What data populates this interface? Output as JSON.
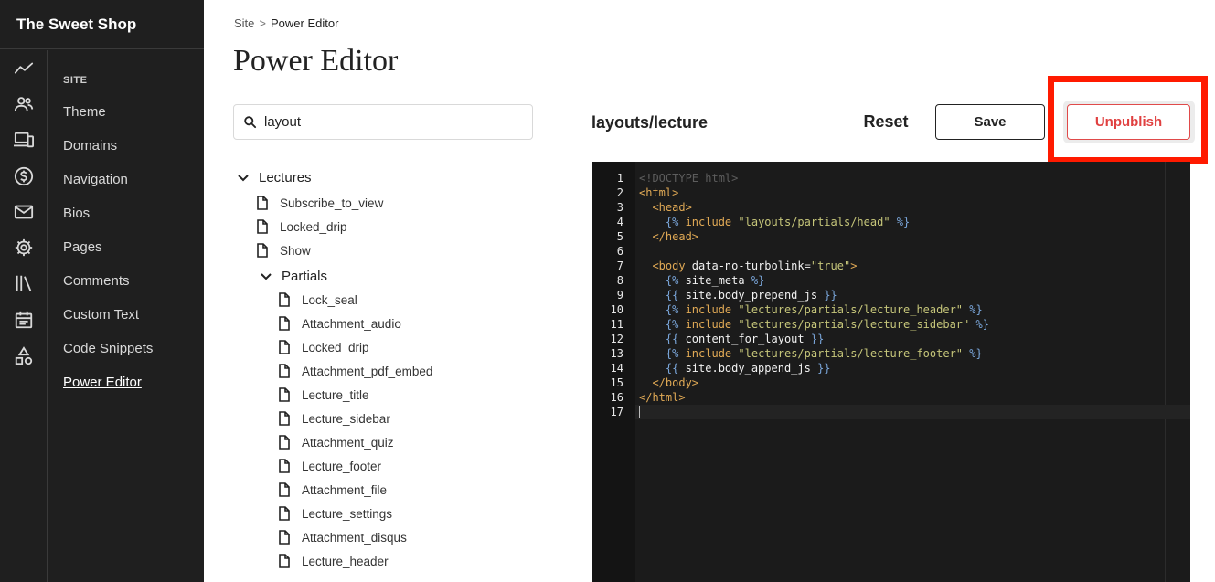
{
  "app": {
    "brand": "The Sweet Shop"
  },
  "sidebar": {
    "section_label": "SITE",
    "icons": [
      "analytics-icon",
      "users-icon",
      "devices-icon",
      "dollar-icon",
      "mail-icon",
      "gear-icon",
      "library-icon",
      "calendar-icon",
      "shapes-icon"
    ],
    "items": [
      {
        "label": "Theme"
      },
      {
        "label": "Domains"
      },
      {
        "label": "Navigation"
      },
      {
        "label": "Bios"
      },
      {
        "label": "Pages"
      },
      {
        "label": "Comments"
      },
      {
        "label": "Custom Text"
      },
      {
        "label": "Code Snippets"
      },
      {
        "label": "Power Editor",
        "active": true
      }
    ]
  },
  "breadcrumb": {
    "root": "Site",
    "separator": ">",
    "current": "Power Editor"
  },
  "page": {
    "title": "Power Editor"
  },
  "search": {
    "value": "layout",
    "placeholder": ""
  },
  "tree": {
    "folder_lectures": "Lectures",
    "lectures_files": [
      "Subscribe_to_view",
      "Locked_drip",
      "Show"
    ],
    "folder_partials": "Partials",
    "partials_files": [
      "Lock_seal",
      "Attachment_audio",
      "Locked_drip",
      "Attachment_pdf_embed",
      "Lecture_title",
      "Lecture_sidebar",
      "Attachment_quiz",
      "Lecture_footer",
      "Attachment_file",
      "Lecture_settings",
      "Attachment_disqus",
      "Lecture_header"
    ]
  },
  "editor": {
    "file_path": "layouts/lecture",
    "reset_label": "Reset",
    "save_label": "Save",
    "unpublish_label": "Unpublish",
    "line_numbers": [
      "1",
      "2",
      "3",
      "4",
      "5",
      "6",
      "7",
      "8",
      "9",
      "10",
      "11",
      "12",
      "13",
      "14",
      "15",
      "16",
      "17"
    ],
    "lines": [
      [
        {
          "t": "<!DOCTYPE html>",
          "c": "cm"
        }
      ],
      [
        {
          "t": "<html>",
          "c": "tag"
        }
      ],
      [
        {
          "t": "  ",
          "c": "pl"
        },
        {
          "t": "<head>",
          "c": "tag"
        }
      ],
      [
        {
          "t": "    ",
          "c": "pl"
        },
        {
          "t": "{%",
          "c": "del"
        },
        {
          "t": " include ",
          "c": "kw"
        },
        {
          "t": "\"layouts/partials/head\"",
          "c": "str"
        },
        {
          "t": " %}",
          "c": "del"
        }
      ],
      [
        {
          "t": "  ",
          "c": "pl"
        },
        {
          "t": "</head>",
          "c": "tag"
        }
      ],
      [],
      [
        {
          "t": "  ",
          "c": "pl"
        },
        {
          "t": "<body",
          "c": "tag"
        },
        {
          "t": " data-no-turbolink",
          "c": "attr"
        },
        {
          "t": "=",
          "c": "pl"
        },
        {
          "t": "\"true\"",
          "c": "str"
        },
        {
          "t": ">",
          "c": "tag"
        }
      ],
      [
        {
          "t": "    ",
          "c": "pl"
        },
        {
          "t": "{%",
          "c": "del"
        },
        {
          "t": " site_meta ",
          "c": "var"
        },
        {
          "t": "%}",
          "c": "del"
        }
      ],
      [
        {
          "t": "    ",
          "c": "pl"
        },
        {
          "t": "{{",
          "c": "del"
        },
        {
          "t": " site.body_prepend_js ",
          "c": "var"
        },
        {
          "t": "}}",
          "c": "del"
        }
      ],
      [
        {
          "t": "    ",
          "c": "pl"
        },
        {
          "t": "{%",
          "c": "del"
        },
        {
          "t": " include ",
          "c": "kw"
        },
        {
          "t": "\"lectures/partials/lecture_header\"",
          "c": "str"
        },
        {
          "t": " %}",
          "c": "del"
        }
      ],
      [
        {
          "t": "    ",
          "c": "pl"
        },
        {
          "t": "{%",
          "c": "del"
        },
        {
          "t": " include ",
          "c": "kw"
        },
        {
          "t": "\"lectures/partials/lecture_sidebar\"",
          "c": "str"
        },
        {
          "t": " %}",
          "c": "del"
        }
      ],
      [
        {
          "t": "    ",
          "c": "pl"
        },
        {
          "t": "{{",
          "c": "del"
        },
        {
          "t": " content_for_layout ",
          "c": "var"
        },
        {
          "t": "}}",
          "c": "del"
        }
      ],
      [
        {
          "t": "    ",
          "c": "pl"
        },
        {
          "t": "{%",
          "c": "del"
        },
        {
          "t": " include ",
          "c": "kw"
        },
        {
          "t": "\"lectures/partials/lecture_footer\"",
          "c": "str"
        },
        {
          "t": " %}",
          "c": "del"
        }
      ],
      [
        {
          "t": "    ",
          "c": "pl"
        },
        {
          "t": "{{",
          "c": "del"
        },
        {
          "t": " site.body_append_js ",
          "c": "var"
        },
        {
          "t": "}}",
          "c": "del"
        }
      ],
      [
        {
          "t": "  ",
          "c": "pl"
        },
        {
          "t": "</body>",
          "c": "tag"
        }
      ],
      [
        {
          "t": "</html>",
          "c": "tag"
        }
      ],
      []
    ]
  },
  "colors": {
    "sidebar_bg": "#1f1f1f",
    "editor_bg": "#1b1b1b",
    "unpublish_red": "#e04040",
    "highlight_red": "#ff1a00"
  }
}
